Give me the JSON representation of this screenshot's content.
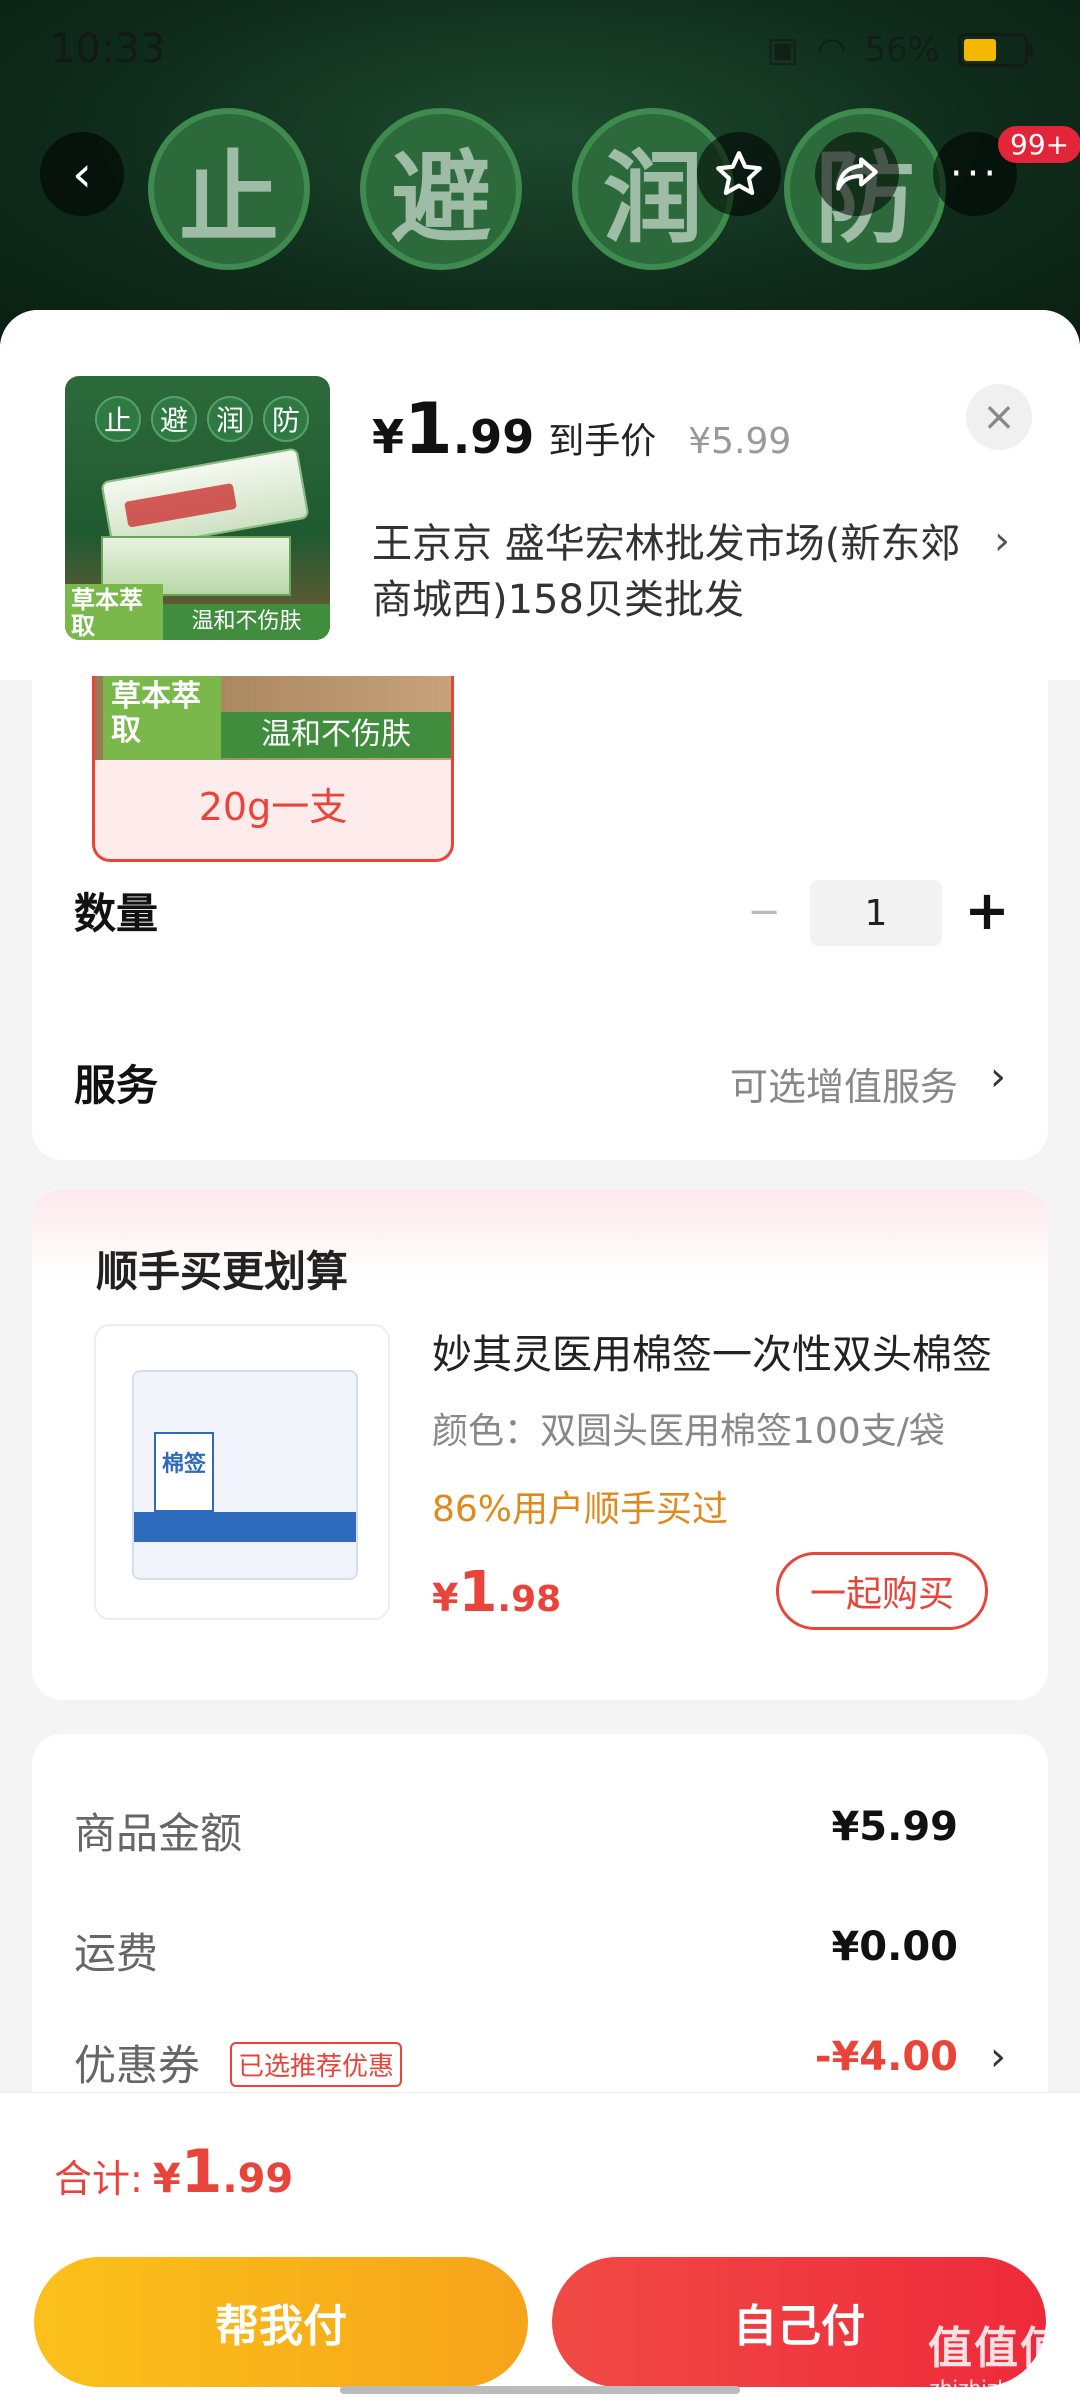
{
  "status_bar": {
    "time": "10:33",
    "battery": "56%"
  },
  "hero": {
    "chars": [
      "止",
      "避",
      "润",
      "防"
    ]
  },
  "nav": {
    "back": "‹",
    "more": "···",
    "badge": "99+"
  },
  "product": {
    "thumb_chars": [
      "止",
      "避",
      "润",
      "防"
    ],
    "thumb_tag_left": "草本萃取",
    "thumb_tag_right": "温和不伤肤",
    "price_symbol": "¥",
    "price_int": "1",
    "price_dec": ".99",
    "price_label": "到手价",
    "original_price": "¥5.99",
    "close": "×",
    "shop": "王京京  盛华宏林批发市场(新东郊商城西)158贝类批发"
  },
  "spec": {
    "tile_left": "草本萃取",
    "tile_right": "温和不伤肤",
    "label": "20g一支"
  },
  "quantity": {
    "label": "数量",
    "minus": "−",
    "value": "1",
    "plus": "+"
  },
  "service": {
    "label": "服务",
    "hint": "可选增值服务"
  },
  "recommend": {
    "title": "顺手买更划算",
    "bag_label": "棉签",
    "item_title": "妙其灵医用棉签一次性双头棉签",
    "item_spec": "颜色：双圆头医用棉签100支/袋",
    "item_promo": "86%用户顺手买过",
    "price_symbol": "¥",
    "price_int": "1",
    "price_dec": ".98",
    "button": "一起购买"
  },
  "summary": {
    "rows": [
      {
        "label": "商品金额",
        "value": "¥5.99"
      },
      {
        "label": "运费",
        "value": "¥0.00"
      },
      {
        "label": "优惠券",
        "value": "-¥4.00",
        "tag": "已选推荐优惠"
      }
    ]
  },
  "footer": {
    "total_label": "合计:",
    "total_symbol": "¥",
    "total_int": "1",
    "total_dec": ".99",
    "help_pay": "帮我付",
    "self_pay": "自己付"
  },
  "watermark": {
    "big": "值值值",
    "small": "zhizhizhi.com"
  },
  "colors": {
    "accent_red": "#e8443a",
    "pay_yellow": "#fbc11b",
    "promo_orange": "#e08a1e"
  }
}
